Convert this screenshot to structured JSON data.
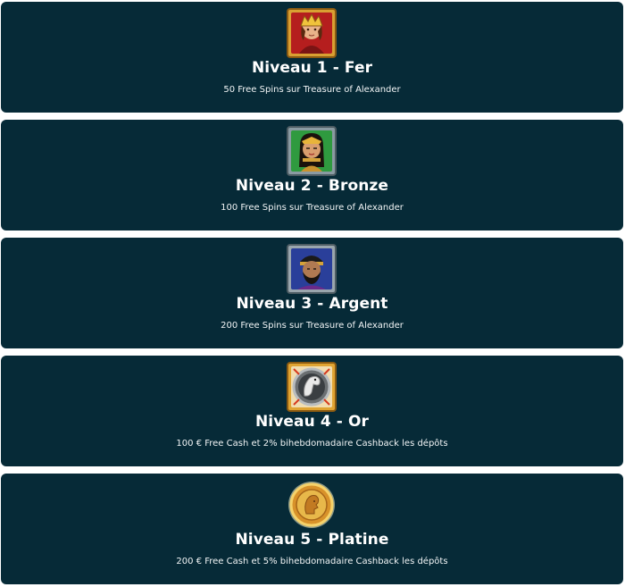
{
  "levels": [
    {
      "icon": "king-portrait-icon",
      "title": "Niveau 1 - Fer",
      "description": "50 Free Spins sur Treasure of Alexander"
    },
    {
      "icon": "queen-portrait-icon",
      "title": "Niveau 2 - Bronze",
      "description": "100 Free Spins sur Treasure of Alexander"
    },
    {
      "icon": "warrior-portrait-icon",
      "title": "Niveau 3 - Argent",
      "description": "200 Free Spins sur Treasure of Alexander"
    },
    {
      "icon": "horse-head-icon",
      "title": "Niveau 4 - Or",
      "description": "100 € Free Cash et 2% bihebdomadaire Cashback les dépôts"
    },
    {
      "icon": "gold-coin-icon",
      "title": "Niveau 5 - Platine",
      "description": "200 € Free Cash et 5% bihebdomadaire Cashback les dépôts"
    }
  ],
  "colors": {
    "card_background": "#062a37",
    "text": "#ffffff"
  }
}
